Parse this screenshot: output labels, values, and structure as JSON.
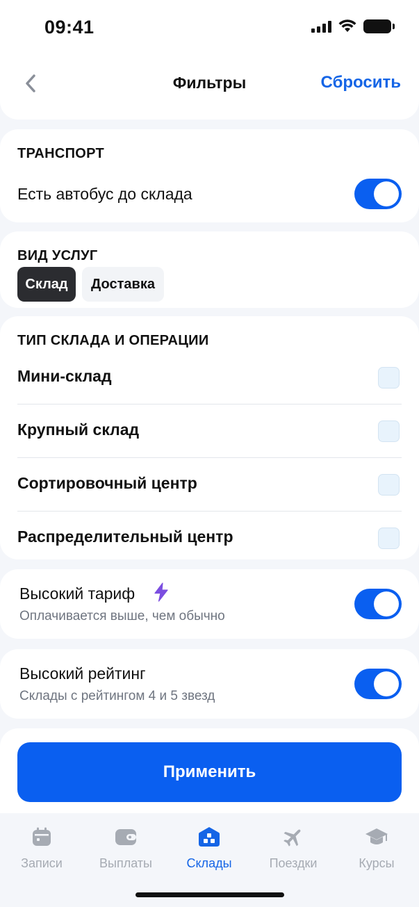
{
  "status": {
    "time": "09:41"
  },
  "header": {
    "title": "Фильтры",
    "reset_label": "Сбросить"
  },
  "transport": {
    "title": "ТРАНСПОРТ",
    "bus_label": "Есть автобус до склада",
    "bus_enabled": true
  },
  "services": {
    "title": "ВИД УСЛУГ",
    "chips": [
      {
        "label": "Склад",
        "selected": true
      },
      {
        "label": "Доставка",
        "selected": false
      }
    ]
  },
  "warehouse_type": {
    "title": "ТИП СКЛАДА И ОПЕРАЦИИ",
    "options": [
      {
        "label": "Мини-склад",
        "checked": false
      },
      {
        "label": "Крупный склад",
        "checked": false
      },
      {
        "label": "Сортировочный центр",
        "checked": false
      },
      {
        "label": "Распределительный центр",
        "checked": false
      }
    ]
  },
  "high_tariff": {
    "label": "Высокий тариф",
    "description": "Оплачивается выше, чем обычно",
    "enabled": true,
    "icon": "lightning-icon"
  },
  "high_rating": {
    "label": "Высокий рейтинг",
    "description": "Склады с рейтингом 4 и 5 звезд",
    "enabled": true
  },
  "apply_label": "Применить",
  "tabs": [
    {
      "label": "Записи",
      "icon": "calendar-icon",
      "active": false
    },
    {
      "label": "Выплаты",
      "icon": "wallet-icon",
      "active": false
    },
    {
      "label": "Склады",
      "icon": "warehouse-icon",
      "active": true
    },
    {
      "label": "Поездки",
      "icon": "plane-icon",
      "active": false
    },
    {
      "label": "Курсы",
      "icon": "graduation-cap-icon",
      "active": false
    }
  ],
  "colors": {
    "accent": "#0a5ff0",
    "link": "#1565e6",
    "chip_active": "#2b2c30",
    "lightning": "#7b4ee0"
  }
}
